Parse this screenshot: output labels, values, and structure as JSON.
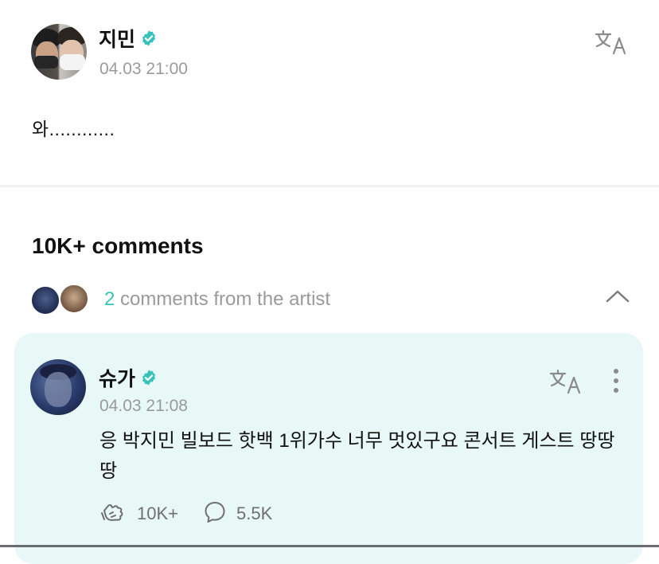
{
  "post": {
    "author": "지민",
    "timestamp": "04.03 21:00",
    "text": "와............",
    "author_avatar": "two-people-avatar",
    "verified_icon": "verified-check-icon",
    "translate_icon": "translate-icon"
  },
  "comments": {
    "title": "10K+ comments",
    "artist_row": {
      "count": "2",
      "label": " comments from the artist",
      "toggle_icon": "chevron-up-icon"
    },
    "items": [
      {
        "author": "슈가",
        "timestamp": "04.03 21:08",
        "text": "응 박지민 빌보드 핫백 1위가수 너무 멋있구요 콘서트 게스트 땅땅땅",
        "likes": "10K+",
        "replies": "5.5K",
        "like_icon": "like-hand-icon",
        "reply_icon": "reply-bubble-icon",
        "more_icon": "more-vertical-icon"
      }
    ]
  },
  "colors": {
    "accent": "#38c3ba",
    "card_background": "#e7f8f6",
    "muted_text": "#9a9a9a"
  }
}
